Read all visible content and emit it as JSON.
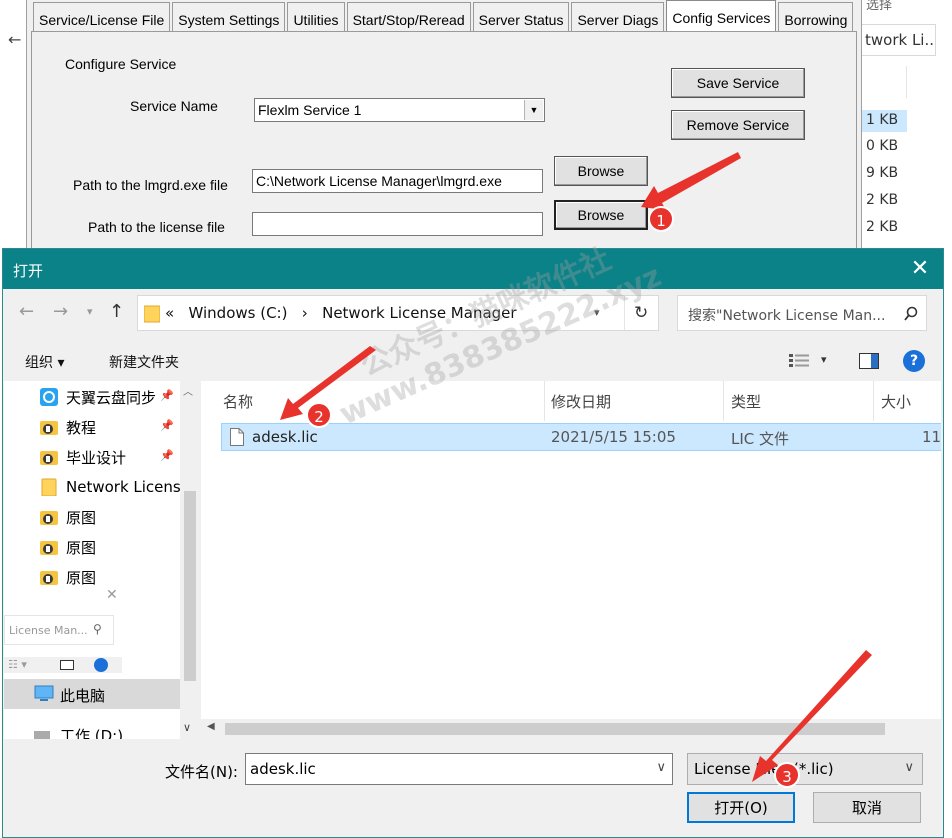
{
  "background": {
    "crumb": "twork Li...",
    "top_text": "选择",
    "sizes": [
      "1 KB",
      "0 KB",
      "9 KB",
      "2 KB",
      "2 KB"
    ]
  },
  "lmtools": {
    "tabs": [
      "Service/License File",
      "System Settings",
      "Utilities",
      "Start/Stop/Reread",
      "Server Status",
      "Server Diags",
      "Config Services",
      "Borrowing"
    ],
    "active_tab": "Config Services",
    "section_title": "Configure Service",
    "service_name_label": "Service Name",
    "service_name_value": "Flexlm Service 1",
    "lmgrd_path_label": "Path to the lmgrd.exe file",
    "lmgrd_path_value": "C:\\Network License Manager\\lmgrd.exe",
    "license_path_label": "Path to the license file",
    "license_path_value": "",
    "save_label": "Save Service",
    "remove_label": "Remove Service",
    "browse_label": "Browse"
  },
  "open_dialog": {
    "title": "打开",
    "close": "✕",
    "address": {
      "prefix": "«",
      "parts": [
        "Windows (C:)",
        "Network License Manager"
      ],
      "separator": "›"
    },
    "search_placeholder": "搜索\"Network License Man...",
    "organize": "组织 ▾",
    "new_folder": "新建文件夹",
    "help": "?",
    "nav_items": [
      {
        "label": "天翼云盘同步",
        "pinned": true,
        "icon": "cloud"
      },
      {
        "label": "教程",
        "pinned": true,
        "icon": "doc"
      },
      {
        "label": "毕业设计",
        "pinned": true,
        "icon": "doc"
      },
      {
        "label": "Network License",
        "pinned": false,
        "icon": "folder"
      },
      {
        "label": "原图",
        "pinned": false,
        "icon": "doc"
      },
      {
        "label": "原图",
        "pinned": false,
        "icon": "doc"
      },
      {
        "label": "原图",
        "pinned": false,
        "icon": "doc"
      }
    ],
    "ghost_search": "License Man...",
    "this_pc": "此电脑",
    "drive_d": "工作 (D:)",
    "columns": [
      "名称",
      "修改日期",
      "类型",
      "大小"
    ],
    "files": [
      {
        "name": "adesk.lic",
        "modified": "2021/5/15 15:05",
        "type": "LIC 文件",
        "size": "11"
      }
    ],
    "filename_label": "文件名(N):",
    "filename_value": "adesk.lic",
    "filetype_value": "License Files (*.lic)",
    "open_label": "打开(O)",
    "cancel_label": "取消"
  },
  "annotations": {
    "badges": [
      "1",
      "2",
      "3"
    ],
    "watermark_lines": [
      "公众号：猫咪软件社",
      "www.838385222.xyz"
    ]
  },
  "colors": {
    "titlebar": "#0b8287",
    "selection": "#cce8ff",
    "badge": "#e8322c",
    "accent_blue": "#1a6fd8"
  }
}
